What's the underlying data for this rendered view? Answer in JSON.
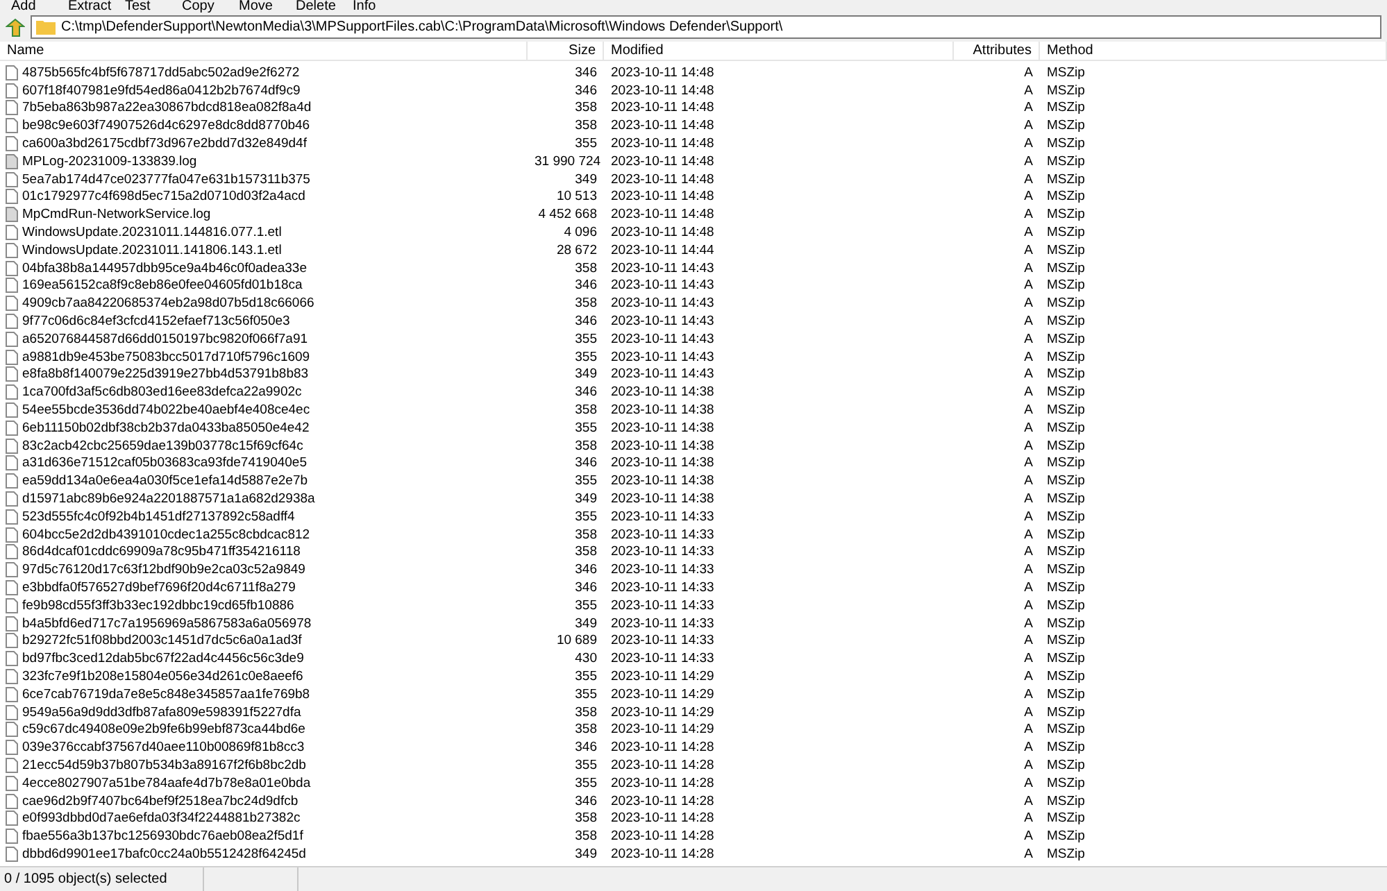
{
  "toolbar": [
    "Add",
    "Extract",
    "Test",
    "Copy",
    "Move",
    "Delete",
    "Info"
  ],
  "address": "C:\\tmp\\DefenderSupport\\NewtonMedia\\3\\MPSupportFiles.cab\\C:\\ProgramData\\Microsoft\\Windows Defender\\Support\\",
  "columns": [
    "Name",
    "Size",
    "Modified",
    "Attributes",
    "Method"
  ],
  "rows": [
    {
      "kind": "file",
      "name": "4875b565fc4bf5f678717dd5abc502ad9e2f6272",
      "size": "346",
      "modified": "2023-10-11 14:48",
      "attributes": "A",
      "method": "MSZip"
    },
    {
      "kind": "file",
      "name": "607f18f407981e9fd54ed86a0412b2b7674df9c9",
      "size": "346",
      "modified": "2023-10-11 14:48",
      "attributes": "A",
      "method": "MSZip"
    },
    {
      "kind": "file",
      "name": "7b5eba863b987a22ea30867bdcd818ea082f8a4d",
      "size": "358",
      "modified": "2023-10-11 14:48",
      "attributes": "A",
      "method": "MSZip"
    },
    {
      "kind": "file",
      "name": "be98c9e603f74907526d4c6297e8dc8dd8770b46",
      "size": "358",
      "modified": "2023-10-11 14:48",
      "attributes": "A",
      "method": "MSZip"
    },
    {
      "kind": "file",
      "name": "ca600a3bd26175cdbf73d967e2bdd7d32e849d4f",
      "size": "355",
      "modified": "2023-10-11 14:48",
      "attributes": "A",
      "method": "MSZip"
    },
    {
      "kind": "log",
      "name": "MPLog-20231009-133839.log",
      "size": "31 990 724",
      "modified": "2023-10-11 14:48",
      "attributes": "A",
      "method": "MSZip"
    },
    {
      "kind": "file",
      "name": "5ea7ab174d47ce023777fa047e631b157311b375",
      "size": "349",
      "modified": "2023-10-11 14:48",
      "attributes": "A",
      "method": "MSZip"
    },
    {
      "kind": "file",
      "name": "01c1792977c4f698d5ec715a2d0710d03f2a4acd",
      "size": "10 513",
      "modified": "2023-10-11 14:48",
      "attributes": "A",
      "method": "MSZip"
    },
    {
      "kind": "log",
      "name": "MpCmdRun-NetworkService.log",
      "size": "4 452 668",
      "modified": "2023-10-11 14:48",
      "attributes": "A",
      "method": "MSZip"
    },
    {
      "kind": "file",
      "name": "WindowsUpdate.20231011.144816.077.1.etl",
      "size": "4 096",
      "modified": "2023-10-11 14:48",
      "attributes": "A",
      "method": "MSZip"
    },
    {
      "kind": "file",
      "name": "WindowsUpdate.20231011.141806.143.1.etl",
      "size": "28 672",
      "modified": "2023-10-11 14:44",
      "attributes": "A",
      "method": "MSZip"
    },
    {
      "kind": "file",
      "name": "04bfa38b8a144957dbb95ce9a4b46c0f0adea33e",
      "size": "358",
      "modified": "2023-10-11 14:43",
      "attributes": "A",
      "method": "MSZip"
    },
    {
      "kind": "file",
      "name": "169ea56152ca8f9c8eb86e0fee04605fd01b18ca",
      "size": "346",
      "modified": "2023-10-11 14:43",
      "attributes": "A",
      "method": "MSZip"
    },
    {
      "kind": "file",
      "name": "4909cb7aa84220685374eb2a98d07b5d18c66066",
      "size": "358",
      "modified": "2023-10-11 14:43",
      "attributes": "A",
      "method": "MSZip"
    },
    {
      "kind": "file",
      "name": "9f77c06d6c84ef3cfcd4152efaef713c56f050e3",
      "size": "346",
      "modified": "2023-10-11 14:43",
      "attributes": "A",
      "method": "MSZip"
    },
    {
      "kind": "file",
      "name": "a652076844587d66dd0150197bc9820f066f7a91",
      "size": "355",
      "modified": "2023-10-11 14:43",
      "attributes": "A",
      "method": "MSZip"
    },
    {
      "kind": "file",
      "name": "a9881db9e453be75083bcc5017d710f5796c1609",
      "size": "355",
      "modified": "2023-10-11 14:43",
      "attributes": "A",
      "method": "MSZip"
    },
    {
      "kind": "file",
      "name": "e8fa8b8f140079e225d3919e27bb4d53791b8b83",
      "size": "349",
      "modified": "2023-10-11 14:43",
      "attributes": "A",
      "method": "MSZip"
    },
    {
      "kind": "file",
      "name": "1ca700fd3af5c6db803ed16ee83defca22a9902c",
      "size": "346",
      "modified": "2023-10-11 14:38",
      "attributes": "A",
      "method": "MSZip"
    },
    {
      "kind": "file",
      "name": "54ee55bcde3536dd74b022be40aebf4e408ce4ec",
      "size": "358",
      "modified": "2023-10-11 14:38",
      "attributes": "A",
      "method": "MSZip"
    },
    {
      "kind": "file",
      "name": "6eb11150b02dbf38cb2b37da0433ba85050e4e42",
      "size": "355",
      "modified": "2023-10-11 14:38",
      "attributes": "A",
      "method": "MSZip"
    },
    {
      "kind": "file",
      "name": "83c2acb42cbc25659dae139b03778c15f69cf64c",
      "size": "358",
      "modified": "2023-10-11 14:38",
      "attributes": "A",
      "method": "MSZip"
    },
    {
      "kind": "file",
      "name": "a31d636e71512caf05b03683ca93fde7419040e5",
      "size": "346",
      "modified": "2023-10-11 14:38",
      "attributes": "A",
      "method": "MSZip"
    },
    {
      "kind": "file",
      "name": "ea59dd134a0e6ea4a030f5ce1efa14d5887e2e7b",
      "size": "355",
      "modified": "2023-10-11 14:38",
      "attributes": "A",
      "method": "MSZip"
    },
    {
      "kind": "file",
      "name": "d15971abc89b6e924a2201887571a1a682d2938a",
      "size": "349",
      "modified": "2023-10-11 14:38",
      "attributes": "A",
      "method": "MSZip"
    },
    {
      "kind": "file",
      "name": "523d555fc4c0f92b4b1451df27137892c58adff4",
      "size": "355",
      "modified": "2023-10-11 14:33",
      "attributes": "A",
      "method": "MSZip"
    },
    {
      "kind": "file",
      "name": "604bcc5e2d2db4391010cdec1a255c8cbdcac812",
      "size": "358",
      "modified": "2023-10-11 14:33",
      "attributes": "A",
      "method": "MSZip"
    },
    {
      "kind": "file",
      "name": "86d4dcaf01cddc69909a78c95b471ff354216118",
      "size": "358",
      "modified": "2023-10-11 14:33",
      "attributes": "A",
      "method": "MSZip"
    },
    {
      "kind": "file",
      "name": "97d5c76120d17c63f12bdf90b9e2ca03c52a9849",
      "size": "346",
      "modified": "2023-10-11 14:33",
      "attributes": "A",
      "method": "MSZip"
    },
    {
      "kind": "file",
      "name": "e3bbdfa0f576527d9bef7696f20d4c6711f8a279",
      "size": "346",
      "modified": "2023-10-11 14:33",
      "attributes": "A",
      "method": "MSZip"
    },
    {
      "kind": "file",
      "name": "fe9b98cd55f3ff3b33ec192dbbc19cd65fb10886",
      "size": "355",
      "modified": "2023-10-11 14:33",
      "attributes": "A",
      "method": "MSZip"
    },
    {
      "kind": "file",
      "name": "b4a5bfd6ed717c7a1956969a5867583a6a056978",
      "size": "349",
      "modified": "2023-10-11 14:33",
      "attributes": "A",
      "method": "MSZip"
    },
    {
      "kind": "file",
      "name": "b29272fc51f08bbd2003c1451d7dc5c6a0a1ad3f",
      "size": "10 689",
      "modified": "2023-10-11 14:33",
      "attributes": "A",
      "method": "MSZip"
    },
    {
      "kind": "file",
      "name": "bd97fbc3ced12dab5bc67f22ad4c4456c56c3de9",
      "size": "430",
      "modified": "2023-10-11 14:33",
      "attributes": "A",
      "method": "MSZip"
    },
    {
      "kind": "file",
      "name": "323fc7e9f1b208e15804e056e34d261c0e8aeef6",
      "size": "355",
      "modified": "2023-10-11 14:29",
      "attributes": "A",
      "method": "MSZip"
    },
    {
      "kind": "file",
      "name": "6ce7cab76719da7e8e5c848e345857aa1fe769b8",
      "size": "355",
      "modified": "2023-10-11 14:29",
      "attributes": "A",
      "method": "MSZip"
    },
    {
      "kind": "file",
      "name": "9549a56a9d9dd3dfb87afa809e598391f5227dfa",
      "size": "358",
      "modified": "2023-10-11 14:29",
      "attributes": "A",
      "method": "MSZip"
    },
    {
      "kind": "file",
      "name": "c59c67dc49408e09e2b9fe6b99ebf873ca44bd6e",
      "size": "358",
      "modified": "2023-10-11 14:29",
      "attributes": "A",
      "method": "MSZip"
    },
    {
      "kind": "file",
      "name": "039e376ccabf37567d40aee110b00869f81b8cc3",
      "size": "346",
      "modified": "2023-10-11 14:28",
      "attributes": "A",
      "method": "MSZip"
    },
    {
      "kind": "file",
      "name": "21ecc54d59b37b807b534b3a89167f2f6b8bc2db",
      "size": "355",
      "modified": "2023-10-11 14:28",
      "attributes": "A",
      "method": "MSZip"
    },
    {
      "kind": "file",
      "name": "4ecce8027907a51be784aafe4d7b78e8a01e0bda",
      "size": "355",
      "modified": "2023-10-11 14:28",
      "attributes": "A",
      "method": "MSZip"
    },
    {
      "kind": "file",
      "name": "cae96d2b9f7407bc64bef9f2518ea7bc24d9dfcb",
      "size": "346",
      "modified": "2023-10-11 14:28",
      "attributes": "A",
      "method": "MSZip"
    },
    {
      "kind": "file",
      "name": "e0f993dbbd0d7ae6efda03f34f2244881b27382c",
      "size": "358",
      "modified": "2023-10-11 14:28",
      "attributes": "A",
      "method": "MSZip"
    },
    {
      "kind": "file",
      "name": "fbae556a3b137bc1256930bdc76aeb08ea2f5d1f",
      "size": "358",
      "modified": "2023-10-11 14:28",
      "attributes": "A",
      "method": "MSZip"
    },
    {
      "kind": "file",
      "name": "dbbd6d9901ee17bafc0cc24a0b5512428f64245d",
      "size": "349",
      "modified": "2023-10-11 14:28",
      "attributes": "A",
      "method": "MSZip"
    }
  ],
  "status_bar": "0 / 1095 object(s) selected"
}
